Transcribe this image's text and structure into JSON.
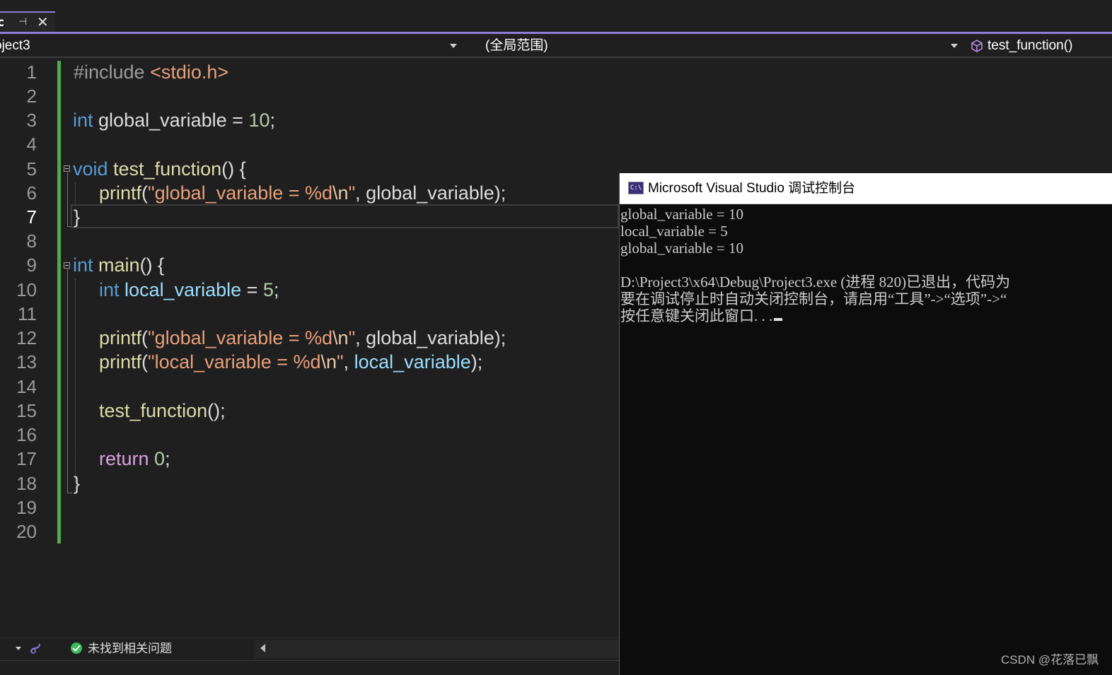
{
  "tab": {
    "name": "c",
    "pin_icon": "pin-icon",
    "close_icon": "close-icon"
  },
  "navbar": {
    "project": "oject3",
    "scope": "(全局范围)",
    "member": "test_function()"
  },
  "editor": {
    "active_line": 7,
    "line_numbers": [
      "1",
      "2",
      "3",
      "4",
      "5",
      "6",
      "7",
      "8",
      "9",
      "10",
      "11",
      "12",
      "13",
      "14",
      "15",
      "16",
      "17",
      "18",
      "19",
      "20"
    ],
    "tokens": {
      "l1_pp": "#include ",
      "l1_hdr": "<stdio.h>",
      "l3_kw": "int",
      "l3_var": " global_variable ",
      "l3_op": "= ",
      "l3_num": "10",
      "l3_end": ";",
      "l5_kw": "void",
      "l5_fn": " test_function",
      "l5_end": "() {",
      "l6_fn": "printf",
      "l6_open": "(",
      "l6_str": "\"global_variable = %d",
      "l6_esc": "\\n",
      "l6_strend": "\"",
      "l6_rest": ", global_variable);",
      "l7": "}",
      "l9_kw": "int",
      "l9_fn": " main",
      "l9_end": "() {",
      "l10_kw": "int",
      "l10_var": " local_variable",
      "l10_op": " = ",
      "l10_num": "5",
      "l10_end": ";",
      "l12_fn": "printf",
      "l12_open": "(",
      "l12_str": "\"global_variable = %d",
      "l12_esc": "\\n",
      "l12_strend": "\"",
      "l12_rest": ", global_variable);",
      "l13_fn": "printf",
      "l13_open": "(",
      "l13_str": "\"local_variable = %d",
      "l13_esc": "\\n",
      "l13_strend": "\"",
      "l13_comma": ", ",
      "l13_var": "local_variable",
      "l13_end": ");",
      "l15_fn": "test_function",
      "l15_end": "();",
      "l17_kw": "return",
      "l17_num": " 0",
      "l17_end": ";",
      "l18": "}"
    }
  },
  "statusbar": {
    "issues": "未找到相关问题"
  },
  "console": {
    "title": "Microsoft Visual Studio 调试控制台",
    "icon_text": "C:\\",
    "lines": [
      "global_variable = 10",
      "local_variable = 5",
      "global_variable = 10",
      "",
      "D:\\Project3\\x64\\Debug\\Project3.exe (进程 820)已退出，代码为",
      "要在调试停止时自动关闭控制台，请启用“工具”->“选项”->“",
      "按任意键关闭此窗口. . ."
    ]
  },
  "watermark": "CSDN @花落已飘",
  "colors": {
    "accent": "#8e7cd8",
    "change_bar": "#4daa4d",
    "keyword": "#569cd6",
    "string": "#e8a07b",
    "function": "#dcdcaa"
  }
}
